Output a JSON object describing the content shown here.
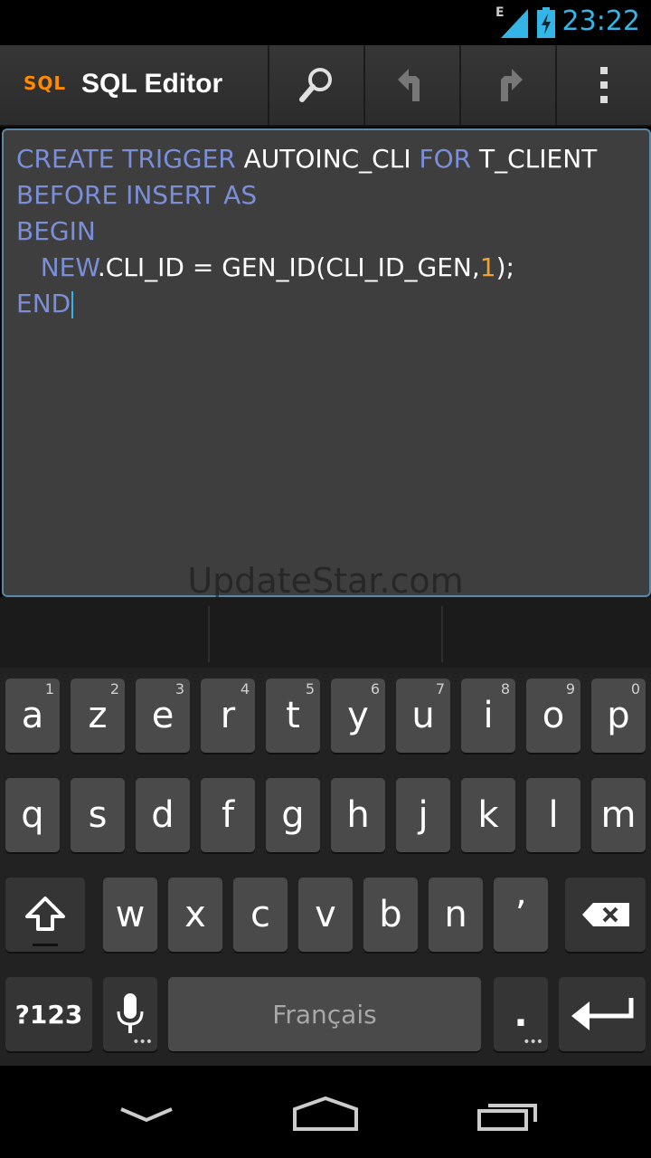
{
  "status": {
    "network_label": "E",
    "time": "23:22"
  },
  "actionbar": {
    "logo": "SQL",
    "title": "SQL Editor",
    "buttons": [
      "search-icon",
      "undo-icon",
      "redo-icon",
      "overflow-menu-icon"
    ]
  },
  "editor": {
    "lines": [
      [
        {
          "t": "CREATE TRIGGER ",
          "c": "kw"
        },
        {
          "t": "AUTOINC_CLI ",
          "c": "id"
        },
        {
          "t": "FOR ",
          "c": "kw"
        },
        {
          "t": "T_CLIENT",
          "c": "id"
        }
      ],
      [
        {
          "t": "BEFORE INSERT AS",
          "c": "kw"
        }
      ],
      [
        {
          "t": "BEGIN",
          "c": "kw"
        }
      ],
      [
        {
          "t": "   ",
          "c": "id"
        },
        {
          "t": "NEW",
          "c": "kw"
        },
        {
          "t": ".CLI_ID = GEN_ID(CLI_ID_GEN,",
          "c": "id"
        },
        {
          "t": "1",
          "c": "num"
        },
        {
          "t": ");",
          "c": "id"
        }
      ],
      [
        {
          "t": "END",
          "c": "kw"
        }
      ]
    ]
  },
  "watermark": "UpdateStar.com",
  "keyboard": {
    "row1": [
      {
        "label": "a",
        "hint": "1"
      },
      {
        "label": "z",
        "hint": "2"
      },
      {
        "label": "e",
        "hint": "3"
      },
      {
        "label": "r",
        "hint": "4"
      },
      {
        "label": "t",
        "hint": "5"
      },
      {
        "label": "y",
        "hint": "6"
      },
      {
        "label": "u",
        "hint": "7"
      },
      {
        "label": "i",
        "hint": "8"
      },
      {
        "label": "o",
        "hint": "9"
      },
      {
        "label": "p",
        "hint": "0"
      }
    ],
    "row2": [
      "q",
      "s",
      "d",
      "f",
      "g",
      "h",
      "j",
      "k",
      "l",
      "m"
    ],
    "row3": [
      "w",
      "x",
      "c",
      "v",
      "b",
      "n",
      "’"
    ],
    "symbols_label": "?123",
    "space_label": "Français",
    "period_label": "."
  },
  "colors": {
    "keyword": "#7b8fd9",
    "number": "#f0a030",
    "accent": "#33b5e5"
  }
}
